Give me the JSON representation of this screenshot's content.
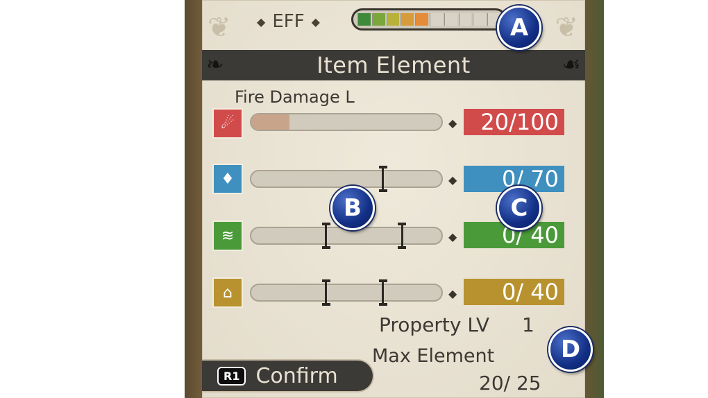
{
  "eff": {
    "label": "EFF",
    "segments": [
      "#3f8a3a",
      "#7aa63b",
      "#b8b23a",
      "#d89b3c",
      "#e58c38",
      "none",
      "none",
      "none",
      "none",
      "none"
    ]
  },
  "header": {
    "title": "Item Element"
  },
  "element": {
    "name": "Fire Damage L",
    "rows": [
      {
        "icon": "fire-icon",
        "color": "#d24b4b",
        "value": "20/100",
        "fill": 0.2,
        "markers": []
      },
      {
        "icon": "ice-icon",
        "color": "#3f8fbf",
        "value": "0/ 70",
        "fill": 0,
        "markers": [
          0.7
        ]
      },
      {
        "icon": "lightning-icon",
        "color": "#4b9a3a",
        "value": "0/ 40",
        "fill": 0,
        "markers": [
          0.4,
          0.8
        ]
      },
      {
        "icon": "wind-icon",
        "color": "#b8922e",
        "value": "0/ 40",
        "fill": 0,
        "markers": [
          0.4,
          0.7
        ]
      }
    ]
  },
  "property": {
    "label": "Property LV",
    "value": "1"
  },
  "max_element": {
    "label": "Max Element",
    "value": "20/ 25"
  },
  "confirm": {
    "button_glyph": "R1",
    "label": "Confirm"
  },
  "badges": {
    "a": "A",
    "b": "B",
    "c": "C",
    "d": "D"
  }
}
